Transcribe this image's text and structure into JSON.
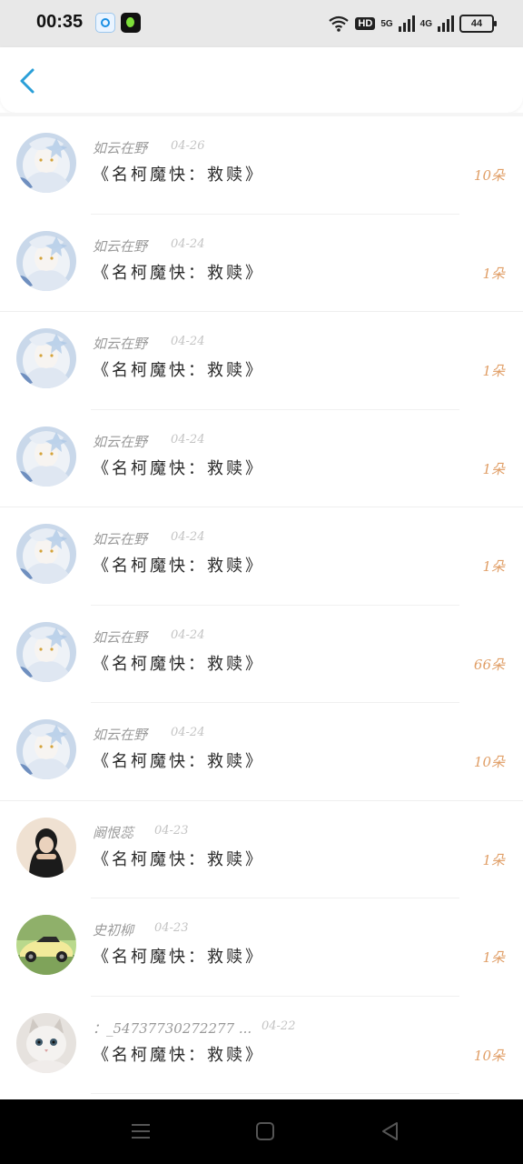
{
  "status_bar": {
    "time": "00:35",
    "signal_5g": "5G",
    "signal_4g": "4G",
    "hd": "HD",
    "battery": "44"
  },
  "gifts": [
    {
      "name": "如云在野",
      "date": "04-26",
      "title": "《名柯魔快：救赎》",
      "count": "10朵",
      "avatar": "anime-girl-avatar"
    },
    {
      "name": "如云在野",
      "date": "04-24",
      "title": "《名柯魔快：救赎》",
      "count": "1朵",
      "avatar": "anime-girl-avatar"
    },
    {
      "name": "如云在野",
      "date": "04-24",
      "title": "《名柯魔快：救赎》",
      "count": "1朵",
      "avatar": "anime-girl-avatar"
    },
    {
      "name": "如云在野",
      "date": "04-24",
      "title": "《名柯魔快：救赎》",
      "count": "1朵",
      "avatar": "anime-girl-avatar"
    },
    {
      "name": "如云在野",
      "date": "04-24",
      "title": "《名柯魔快：救赎》",
      "count": "1朵",
      "avatar": "anime-girl-avatar"
    },
    {
      "name": "如云在野",
      "date": "04-24",
      "title": "《名柯魔快：救赎》",
      "count": "66朵",
      "avatar": "anime-girl-avatar"
    },
    {
      "name": "如云在野",
      "date": "04-24",
      "title": "《名柯魔快：救赎》",
      "count": "10朵",
      "avatar": "anime-girl-avatar"
    },
    {
      "name": "阚恨蕊",
      "date": "04-23",
      "title": "《名柯魔快：救赎》",
      "count": "1朵",
      "avatar": "dark-haired-girl-avatar"
    },
    {
      "name": "史初柳",
      "date": "04-23",
      "title": "《名柯魔快：救赎》",
      "count": "1朵",
      "avatar": "sports-car-avatar"
    },
    {
      "name": "：_54737730272277 ...",
      "date": "04-22",
      "title": "《名柯魔快：救赎》",
      "count": "10朵",
      "avatar": "cat-avatar"
    }
  ]
}
